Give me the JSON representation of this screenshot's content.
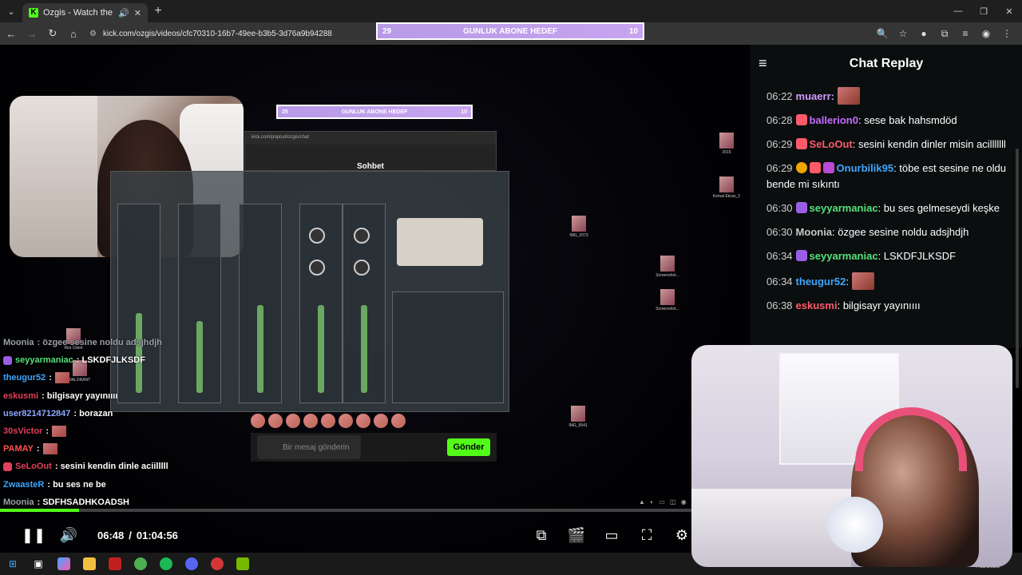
{
  "browser": {
    "tab_title": "Ozgis - Watch the VOD on",
    "tab_favicon": "K",
    "url": "kick.com/ozgis/videos/cfc70310-16b7-49ee-b3b5-3d76a9b94288"
  },
  "goal": {
    "left": "29",
    "label": "GUNLUK ABONE HEDEF",
    "right": "10"
  },
  "inner_goal": {
    "left": "25",
    "label": "GUNLUK ABONE HEDEF",
    "right": "10"
  },
  "stream_overlay": {
    "chat_window_url": "kick.com/popout/ozgis/chat",
    "chat_title": "Sohbet",
    "message_placeholder": "Bir mesaj gönderin",
    "send_label": "Gönder"
  },
  "overlay_chat": [
    {
      "user": "Moonia",
      "color": "#9aa0a8",
      "text": ": özgee sesine noldu adsjhdjh"
    },
    {
      "user": "seyyarmaniac",
      "color": "#55e07a",
      "text": ": LSKDFJLKSDF"
    },
    {
      "user": "theugur52",
      "color": "#3ea6ff",
      "text": ":"
    },
    {
      "user": "eskusmi",
      "color": "#e0405a",
      "text": ": bilgisayr yayınıııı"
    },
    {
      "user": "user8214712847",
      "color": "#8fa6ff",
      "text": ": borazan"
    },
    {
      "user": "30sVictor",
      "color": "#e0405a",
      "text": ":"
    },
    {
      "user": "PAMAY",
      "color": "#ff5050",
      "text": ":"
    },
    {
      "user": "SeLoOut",
      "color": "#e0405a",
      "text": ": sesini kendin dinle aciilllll"
    },
    {
      "user": "ZwaasteR",
      "color": "#3ea6ff",
      "text": ": bu ses ne be"
    },
    {
      "user": "Moonia",
      "color": "#9aa0a8",
      "text": ": SDFHSADHKOADSH"
    }
  ],
  "player": {
    "current_time": "06:48",
    "separator": "/",
    "duration": "01:04:56",
    "progress": 0.105
  },
  "chat_replay": {
    "title": "Chat Replay",
    "messages": [
      {
        "time": "06:22",
        "user": "muaerr:",
        "color": "#d39aff",
        "text": "",
        "emote": true
      },
      {
        "time": "06:28",
        "user": "ballerion0",
        "color": "#c56cff",
        "text": ": sese bak hahsmdöd"
      },
      {
        "time": "06:29",
        "user": "SeLoOut",
        "color": "#ff5a6a",
        "text": ": sesini kendin dinler misin acilllllll"
      },
      {
        "time": "06:29",
        "user": "Onurbilik95",
        "color": "#3ea6ff",
        "text": ": töbe est sesine ne oldu bende mi sıkıntı"
      },
      {
        "time": "06:30",
        "user": "seyyarmaniac",
        "color": "#55e07a",
        "text": ": bu ses gelmeseydi keşke"
      },
      {
        "time": "06:30",
        "user": "Moonia",
        "color": "#c7c7c7",
        "text": ": özgee sesine noldu adsjhdjh"
      },
      {
        "time": "06:34",
        "user": "seyyarmaniac",
        "color": "#55e07a",
        "text": ": LSKDFJLKSDF"
      },
      {
        "time": "06:34",
        "user": "theugur52",
        "color": "#3ea6ff",
        "text": ":",
        "emote": true
      },
      {
        "time": "06:38",
        "user": "eskusmi",
        "color": "#ff5a6a",
        "text": ": bilgisayr yayınıııı"
      }
    ]
  },
  "desktop_icons": [
    {
      "label": "2016"
    },
    {
      "label": "Kemal Ekran_2"
    },
    {
      "label": "IMG_2073"
    },
    {
      "label": "Screenshot..."
    },
    {
      "label": "Screenshot..."
    },
    {
      "label": "IMG_9541"
    },
    {
      "label": "Riot Client"
    },
    {
      "label": "VALORANT"
    }
  ],
  "taskbar": {
    "clock": "7.11.2025"
  },
  "colors": {
    "kick_green": "#53fc18",
    "goal_purple": "#c3a1ec",
    "panel_bg": "#0b0e0f"
  }
}
